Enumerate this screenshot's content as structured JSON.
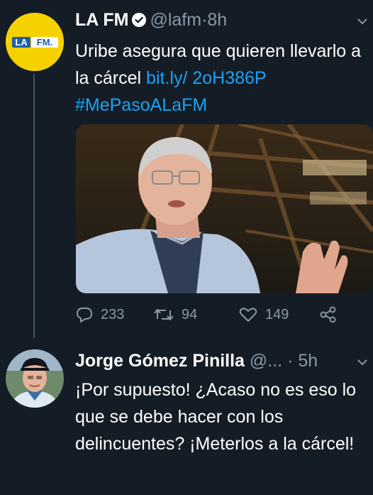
{
  "tweets": [
    {
      "avatar_text": "LA FM.",
      "name": "LA FM",
      "handle": "@lafm",
      "separator": "·",
      "time": "8h",
      "text": "Uribe asegura que quieren llevarlo a la cárcel ",
      "link": "bit.ly/ 2oH386P",
      "hashtag": "#MePasoALaFM",
      "media_icon": "photo-man-gesturing",
      "actions": {
        "replies": "233",
        "retweets": "94",
        "likes": "149"
      }
    },
    {
      "name": "Jorge Gómez Pinilla",
      "handle": "@...",
      "separator": "·",
      "time": "5h",
      "text": "¡Por supuesto! ¿Acaso no es eso lo que se debe hacer con los delincuentes? ¡Meterlos a la cárcel!"
    }
  ],
  "colors": {
    "background": "#141d26",
    "primary_text": "#ffffff",
    "secondary_text": "#8899a6",
    "link": "#1da1f2",
    "thread_line": "#3d5466",
    "lafm_yellow": "#f6d100",
    "lafm_blue": "#1f5fa8"
  }
}
